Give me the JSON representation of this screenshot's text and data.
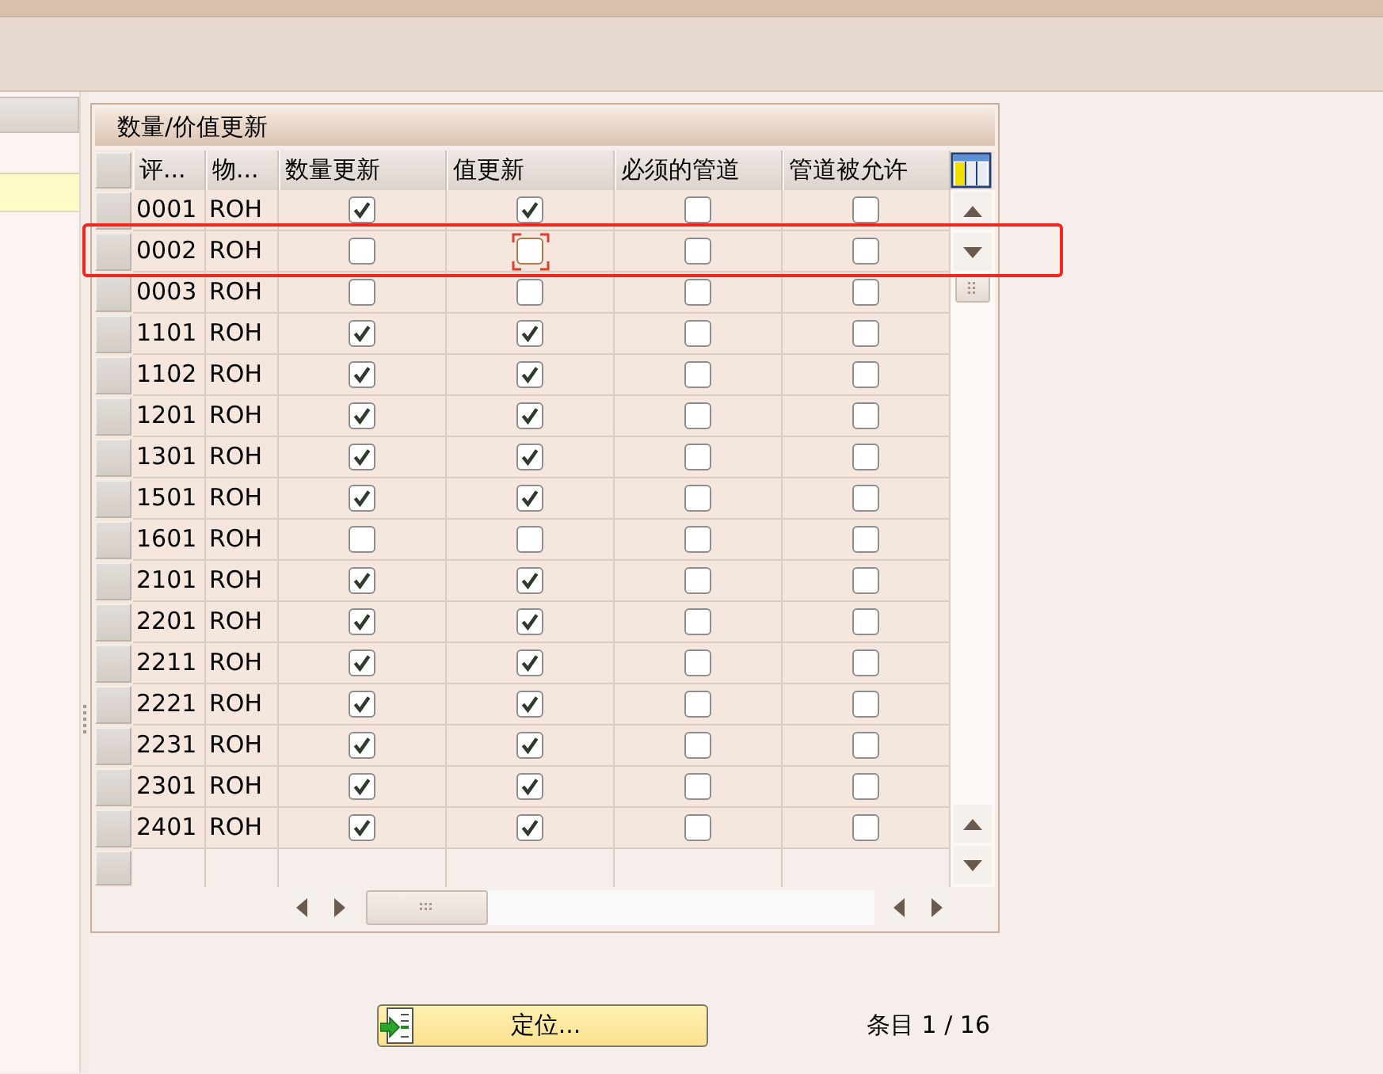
{
  "panel": {
    "title": "数量/价值更新"
  },
  "table": {
    "columns": [
      {
        "label": "评...",
        "kind": "text"
      },
      {
        "label": "物...",
        "kind": "text"
      },
      {
        "label": "数量更新",
        "kind": "check"
      },
      {
        "label": "值更新",
        "kind": "check"
      },
      {
        "label": "必须的管道",
        "kind": "check"
      },
      {
        "label": "管道被允许",
        "kind": "check"
      }
    ],
    "rows": [
      {
        "cells": [
          "0001",
          "ROH"
        ],
        "checks": [
          {
            "checked": true,
            "focused": false
          },
          {
            "checked": true,
            "focused": false
          },
          {
            "checked": false,
            "focused": false
          },
          {
            "checked": false,
            "focused": false
          }
        ],
        "highlighted": false
      },
      {
        "cells": [
          "0002",
          "ROH"
        ],
        "checks": [
          {
            "checked": false,
            "focused": false
          },
          {
            "checked": false,
            "focused": true
          },
          {
            "checked": false,
            "focused": false
          },
          {
            "checked": false,
            "focused": false
          }
        ],
        "highlighted": true
      },
      {
        "cells": [
          "0003",
          "ROH"
        ],
        "checks": [
          {
            "checked": false,
            "focused": false
          },
          {
            "checked": false,
            "focused": false
          },
          {
            "checked": false,
            "focused": false
          },
          {
            "checked": false,
            "focused": false
          }
        ],
        "highlighted": false
      },
      {
        "cells": [
          "1101",
          "ROH"
        ],
        "checks": [
          {
            "checked": true,
            "focused": false
          },
          {
            "checked": true,
            "focused": false
          },
          {
            "checked": false,
            "focused": false
          },
          {
            "checked": false,
            "focused": false
          }
        ],
        "highlighted": false
      },
      {
        "cells": [
          "1102",
          "ROH"
        ],
        "checks": [
          {
            "checked": true,
            "focused": false
          },
          {
            "checked": true,
            "focused": false
          },
          {
            "checked": false,
            "focused": false
          },
          {
            "checked": false,
            "focused": false
          }
        ],
        "highlighted": false
      },
      {
        "cells": [
          "1201",
          "ROH"
        ],
        "checks": [
          {
            "checked": true,
            "focused": false
          },
          {
            "checked": true,
            "focused": false
          },
          {
            "checked": false,
            "focused": false
          },
          {
            "checked": false,
            "focused": false
          }
        ],
        "highlighted": false
      },
      {
        "cells": [
          "1301",
          "ROH"
        ],
        "checks": [
          {
            "checked": true,
            "focused": false
          },
          {
            "checked": true,
            "focused": false
          },
          {
            "checked": false,
            "focused": false
          },
          {
            "checked": false,
            "focused": false
          }
        ],
        "highlighted": false
      },
      {
        "cells": [
          "1501",
          "ROH"
        ],
        "checks": [
          {
            "checked": true,
            "focused": false
          },
          {
            "checked": true,
            "focused": false
          },
          {
            "checked": false,
            "focused": false
          },
          {
            "checked": false,
            "focused": false
          }
        ],
        "highlighted": false
      },
      {
        "cells": [
          "1601",
          "ROH"
        ],
        "checks": [
          {
            "checked": false,
            "focused": false
          },
          {
            "checked": false,
            "focused": false
          },
          {
            "checked": false,
            "focused": false
          },
          {
            "checked": false,
            "focused": false
          }
        ],
        "highlighted": false
      },
      {
        "cells": [
          "2101",
          "ROH"
        ],
        "checks": [
          {
            "checked": true,
            "focused": false
          },
          {
            "checked": true,
            "focused": false
          },
          {
            "checked": false,
            "focused": false
          },
          {
            "checked": false,
            "focused": false
          }
        ],
        "highlighted": false
      },
      {
        "cells": [
          "2201",
          "ROH"
        ],
        "checks": [
          {
            "checked": true,
            "focused": false
          },
          {
            "checked": true,
            "focused": false
          },
          {
            "checked": false,
            "focused": false
          },
          {
            "checked": false,
            "focused": false
          }
        ],
        "highlighted": false
      },
      {
        "cells": [
          "2211",
          "ROH"
        ],
        "checks": [
          {
            "checked": true,
            "focused": false
          },
          {
            "checked": true,
            "focused": false
          },
          {
            "checked": false,
            "focused": false
          },
          {
            "checked": false,
            "focused": false
          }
        ],
        "highlighted": false
      },
      {
        "cells": [
          "2221",
          "ROH"
        ],
        "checks": [
          {
            "checked": true,
            "focused": false
          },
          {
            "checked": true,
            "focused": false
          },
          {
            "checked": false,
            "focused": false
          },
          {
            "checked": false,
            "focused": false
          }
        ],
        "highlighted": false
      },
      {
        "cells": [
          "2231",
          "ROH"
        ],
        "checks": [
          {
            "checked": true,
            "focused": false
          },
          {
            "checked": true,
            "focused": false
          },
          {
            "checked": false,
            "focused": false
          },
          {
            "checked": false,
            "focused": false
          }
        ],
        "highlighted": false
      },
      {
        "cells": [
          "2301",
          "ROH"
        ],
        "checks": [
          {
            "checked": true,
            "focused": false
          },
          {
            "checked": true,
            "focused": false
          },
          {
            "checked": false,
            "focused": false
          },
          {
            "checked": false,
            "focused": false
          }
        ],
        "highlighted": false
      },
      {
        "cells": [
          "2401",
          "ROH"
        ],
        "checks": [
          {
            "checked": true,
            "focused": false
          },
          {
            "checked": true,
            "focused": false
          },
          {
            "checked": false,
            "focused": false
          },
          {
            "checked": false,
            "focused": false
          }
        ],
        "highlighted": false
      }
    ]
  },
  "locate_button": {
    "label": "定位..."
  },
  "entry_counter": "条目 1 / 16"
}
